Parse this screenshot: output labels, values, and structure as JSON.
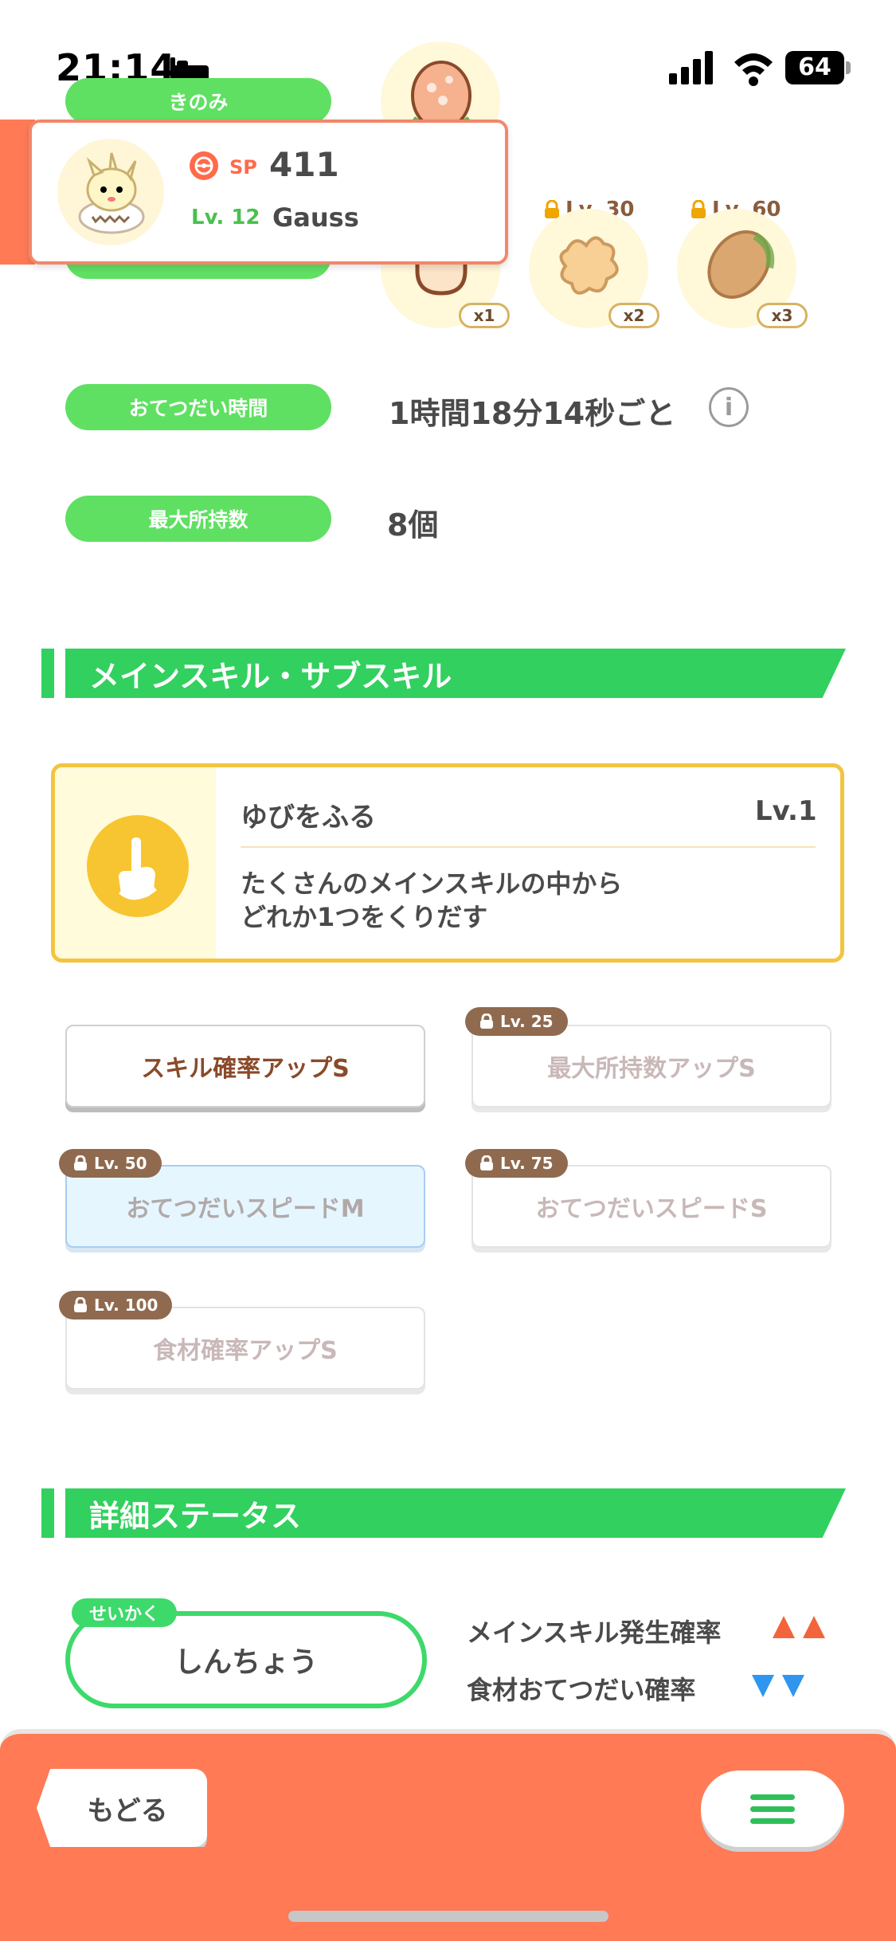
{
  "status_bar": {
    "time": "21:14",
    "battery": "64"
  },
  "berry": {
    "label": "きのみ"
  },
  "popup": {
    "sp_label": "SP",
    "sp_value": "411",
    "level": "Lv. 12",
    "name": "Gauss"
  },
  "ingredients": {
    "locks": [
      {
        "level": "Lv. 30",
        "count": "x2"
      },
      {
        "level": "Lv. 60",
        "count": "x3"
      }
    ],
    "first_count": "x1"
  },
  "help_time": {
    "label": "おてつだい時間",
    "value": "1時間18分14秒ごと"
  },
  "max_carry": {
    "label": "最大所持数",
    "value": "8個"
  },
  "section_skills": {
    "title": "メインスキル・サブスキル"
  },
  "main_skill": {
    "name": "ゆびをふる",
    "level": "Lv.1",
    "desc_line1": "たくさんのメインスキルの中から",
    "desc_line2": "どれか1つをくりだす"
  },
  "sub_skills": [
    {
      "label": "スキル確率アップS",
      "lock": ""
    },
    {
      "label": "最大所持数アップS",
      "lock": "Lv. 25"
    },
    {
      "label": "おてつだいスピードM",
      "lock": "Lv. 50"
    },
    {
      "label": "おてつだいスピードS",
      "lock": "Lv. 75"
    },
    {
      "label": "食材確率アップS",
      "lock": "Lv. 100"
    }
  ],
  "section_details": {
    "title": "詳細ステータス"
  },
  "nature": {
    "tag": "せいかく",
    "value": "しんちょう",
    "up_label": "メインスキル発生確率",
    "down_label": "食材おてつだい確率",
    "colors": {
      "up": "#f2643c",
      "down": "#2f96f0"
    }
  },
  "bottom_bar": {
    "back_label": "もどる"
  },
  "colors": {
    "green": "#32d05f",
    "orange": "#ff7a55",
    "gold": "#f2c440"
  }
}
